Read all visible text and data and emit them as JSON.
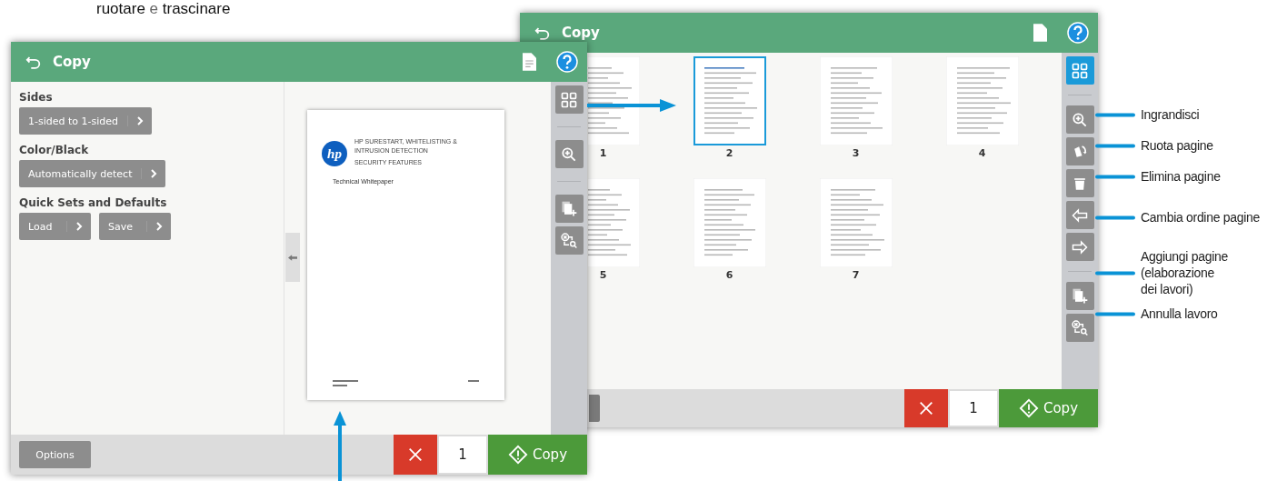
{
  "caption": "**ruotare** e **trascinare**",
  "thumbnail_window": {
    "title": "Copy",
    "pages": [
      {
        "number": "1",
        "selected": false
      },
      {
        "number": "2",
        "selected": true
      },
      {
        "number": "3",
        "selected": false
      },
      {
        "number": "4",
        "selected": false
      },
      {
        "number": "5",
        "selected": false
      },
      {
        "number": "6",
        "selected": false
      },
      {
        "number": "7",
        "selected": false
      }
    ],
    "toolbar": [
      {
        "kind": "grid",
        "selected": true
      },
      {
        "kind": "separator"
      },
      {
        "kind": "zoom",
        "selected": false
      },
      {
        "kind": "rotate",
        "selected": false
      },
      {
        "kind": "delete",
        "selected": false
      },
      {
        "kind": "move_left",
        "selected": false
      },
      {
        "kind": "move_right",
        "selected": false
      },
      {
        "kind": "separator"
      },
      {
        "kind": "add_pages",
        "selected": false
      },
      {
        "kind": "cancel_job",
        "selected": false
      }
    ],
    "copies": "1",
    "start_label": "Copy"
  },
  "preview_window": {
    "title": "Copy",
    "settings": [
      {
        "label": "Sides",
        "buttons": [
          "1-sided to 1-sided"
        ]
      },
      {
        "label": "Color/Black",
        "buttons": [
          "Automatically detect"
        ]
      },
      {
        "label": "Quick Sets and Defaults",
        "buttons": [
          "Load",
          "Save"
        ]
      }
    ],
    "preview_page": {
      "logo": "hp",
      "heading_lines": [
        "HP SURESTART, WHITELISTING &",
        "INTRUSION DETECTION",
        "SECURITY FEATURES"
      ],
      "subtitle": "Technical Whitepaper"
    },
    "toolbar": [
      {
        "kind": "grid",
        "selected": false
      },
      {
        "kind": "separator"
      },
      {
        "kind": "zoom",
        "selected": false
      },
      {
        "kind": "separator"
      },
      {
        "kind": "add_pages",
        "selected": false
      },
      {
        "kind": "cancel_job",
        "selected": false
      }
    ],
    "options_button": "Options",
    "copies": "1",
    "start_label": "Copy"
  },
  "callouts": [
    {
      "label": "Ingrandisci"
    },
    {
      "label": "Ruota pagine"
    },
    {
      "label": "Elimina pagine"
    },
    {
      "label": "Cambia ordine pagine"
    },
    {
      "label": "Aggiungi pagine\n(elaborazione\ndei lavori)"
    },
    {
      "label": "Annulla lavoro"
    }
  ]
}
